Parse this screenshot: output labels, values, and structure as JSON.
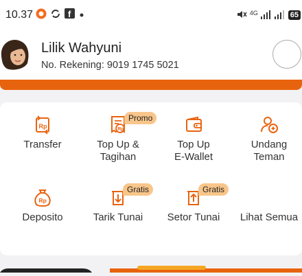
{
  "status_bar": {
    "time": "10.37",
    "network": "4G",
    "battery": "65"
  },
  "profile": {
    "name": "Lilik Wahyuni",
    "account_label": "No. Rekening: 9019 1745 5021"
  },
  "menu": {
    "items": [
      {
        "label": "Transfer",
        "icon": "transfer-rp-icon",
        "badge": ""
      },
      {
        "label": "Top Up &\nTagihan",
        "icon": "bill-rp-icon",
        "badge": "Promo"
      },
      {
        "label": "Top Up\nE-Wallet",
        "icon": "wallet-icon",
        "badge": ""
      },
      {
        "label": "Undang\nTeman",
        "icon": "invite-friends-icon",
        "badge": ""
      },
      {
        "label": "Deposito",
        "icon": "moneybag-rp-icon",
        "badge": ""
      },
      {
        "label": "Tarik Tunai",
        "icon": "withdraw-cash-icon",
        "badge": "Gratis"
      },
      {
        "label": "Setor Tunai",
        "icon": "deposit-cash-icon",
        "badge": "Gratis"
      },
      {
        "label": "Lihat Semua",
        "icon": "",
        "badge": ""
      }
    ]
  },
  "colors": {
    "accent": "#e8630e",
    "badge": "#f8c58a"
  }
}
